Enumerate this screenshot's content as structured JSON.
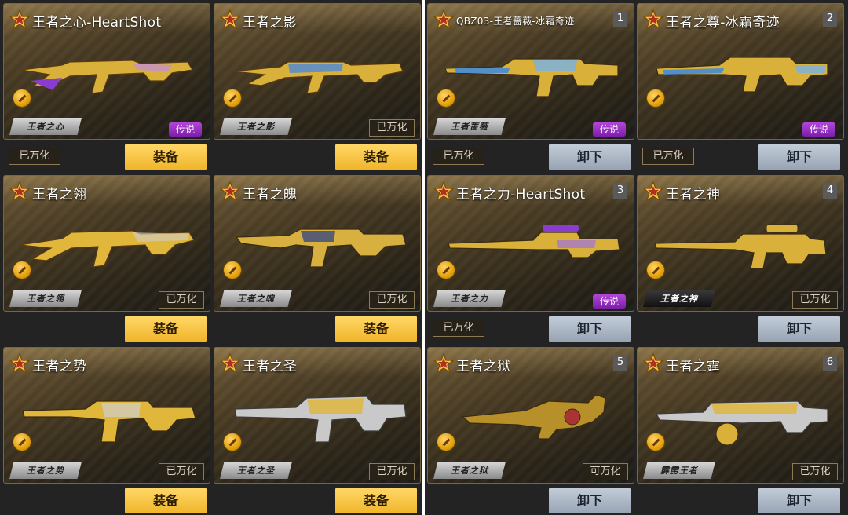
{
  "panels": [
    {
      "cards": [
        {
          "title": "王者之心-HeartShot",
          "tag_plate": "王者之心",
          "badge": "传说",
          "status": "已万化",
          "action": "装备",
          "rank": ""
        },
        {
          "title": "王者之影",
          "tag_plate": "王者之影",
          "badge": "",
          "status": "已万化",
          "action": "装备",
          "rank": ""
        },
        {
          "title": "王者之翎",
          "tag_plate": "王者之翎",
          "badge": "",
          "status": "已万化",
          "action": "装备",
          "rank": ""
        },
        {
          "title": "王者之魄",
          "tag_plate": "王者之魄",
          "badge": "",
          "status": "已万化",
          "action": "装备",
          "rank": ""
        },
        {
          "title": "王者之势",
          "tag_plate": "王者之势",
          "badge": "",
          "status": "已万化",
          "action": "装备",
          "rank": ""
        },
        {
          "title": "王者之圣",
          "tag_plate": "王者之圣",
          "badge": "",
          "status": "已万化",
          "action": "装备",
          "rank": ""
        }
      ]
    },
    {
      "cards": [
        {
          "title": "QBZ03-王者蔷薇-冰霜奇迹",
          "tag_plate": "王者蔷薇",
          "badge": "传说",
          "status": "已万化",
          "action": "卸下",
          "rank": "1"
        },
        {
          "title": "王者之尊-冰霜奇迹",
          "tag_plate": "",
          "badge": "传说",
          "status": "已万化",
          "action": "卸下",
          "rank": "2"
        },
        {
          "title": "王者之力-HeartShot",
          "tag_plate": "王者之力",
          "badge": "传说",
          "status": "已万化",
          "action": "卸下",
          "rank": "3"
        },
        {
          "title": "王者之神",
          "tag_plate": "王者之神",
          "badge": "",
          "status": "已万化",
          "action": "卸下",
          "rank": "4"
        },
        {
          "title": "王者之狱",
          "tag_plate": "王者之狱",
          "badge": "",
          "status": "可万化",
          "action": "卸下",
          "rank": "5"
        },
        {
          "title": "王者之霆",
          "tag_plate": "霹雳王者",
          "badge": "",
          "status": "已万化",
          "action": "卸下",
          "rank": "6"
        }
      ]
    }
  ],
  "colors": {
    "equip_button": "#f0b52a",
    "unequip_button": "#a8b3c2",
    "legend_badge": "#9a2fc8",
    "card_border": "#7a6540"
  },
  "icons": {
    "title_icon": "crown-star-icon",
    "coin_icon": "gold-coin-icon"
  }
}
